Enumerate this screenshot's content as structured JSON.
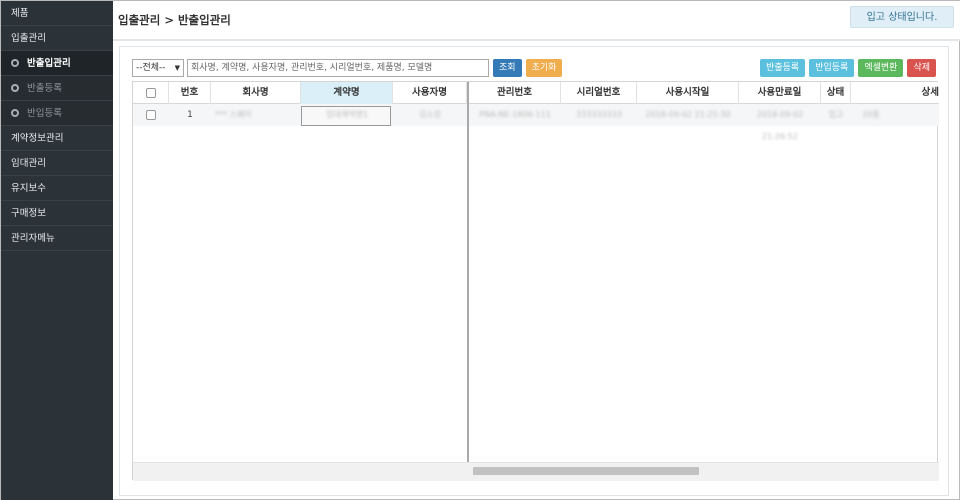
{
  "sidebar": {
    "items": [
      {
        "label": "제품"
      },
      {
        "label": "입출관리"
      },
      {
        "label": "반출입관리"
      },
      {
        "label": "반출등록"
      },
      {
        "label": "반입등록"
      },
      {
        "label": "계약정보관리"
      },
      {
        "label": "임대관리"
      },
      {
        "label": "유지보수"
      },
      {
        "label": "구매정보"
      },
      {
        "label": "관리자메뉴"
      }
    ]
  },
  "header": {
    "breadcrumb": "입출관리 > 반출입관리",
    "status_message": "입고 상태입니다."
  },
  "toolbar": {
    "filter_value": "--전체--",
    "search_placeholder": "회사명, 계약명, 사용자명, 관리번호, 시리얼번호, 제품명, 모델명",
    "query_button": "조회",
    "reset_button": "초기화",
    "carry_out_button": "반출등록",
    "carry_in_button": "반입등록",
    "excel_button": "엑셀변환",
    "delete_button": "삭제"
  },
  "grid": {
    "columns": [
      "번호",
      "회사명",
      "계약명",
      "사용자명",
      "관리번호",
      "시리얼번호",
      "사용시작일",
      "사용만료일",
      "상태",
      "상세"
    ],
    "rows": [
      {
        "no": "1",
        "company": "*** 스페이",
        "contract": "임대계약명1",
        "user": "김소장",
        "mgmt_no": "PNA-NE-1806-111",
        "serial": "333333333",
        "start": "2018-09-02 21:25:30",
        "end": "2018-09-02 21:26:52",
        "status": "입고",
        "detail": "20통"
      }
    ]
  },
  "colors": {
    "sidebar_bg": "#2c3338",
    "primary": "#337ab7",
    "warning": "#f0ad4e",
    "info": "#5bc0de",
    "success": "#5cb85c",
    "danger": "#d9534f"
  }
}
